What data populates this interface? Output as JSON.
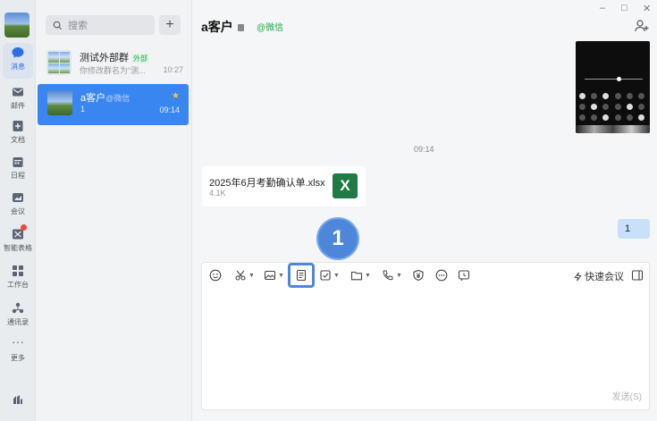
{
  "nav": {
    "items": [
      {
        "label": "消息",
        "icon": "chat-bubble-icon",
        "active": true
      },
      {
        "label": "邮件",
        "icon": "mail-icon"
      },
      {
        "label": "文档",
        "icon": "document-icon"
      },
      {
        "label": "日程",
        "icon": "calendar-icon"
      },
      {
        "label": "会议",
        "icon": "meeting-icon"
      },
      {
        "label": "智能表格",
        "icon": "smart-table-icon"
      },
      {
        "label": "工作台",
        "icon": "workbench-icon"
      },
      {
        "label": "通讯录",
        "icon": "contacts-icon"
      },
      {
        "label": "更多",
        "icon": "more-icon"
      }
    ]
  },
  "search": {
    "placeholder": "搜索"
  },
  "conversations": [
    {
      "name": "测试外部群",
      "tag": "外部",
      "preview": "你修改群名为“测...",
      "time": "10:27"
    },
    {
      "name": "a客户",
      "tag": "@微信",
      "preview": "1",
      "time": "09:14",
      "starred": true
    }
  ],
  "chat": {
    "title": "a客户",
    "tag": "@微信",
    "time_separator": "09:14",
    "file": {
      "name": "2025年6月考勤确认单.xlsx",
      "size": "4.1K",
      "badge": "X"
    },
    "my_message": "1",
    "step_badge": "1",
    "toolbar": {
      "quick_meeting": "快速会议"
    },
    "send_label": "发送(S)"
  },
  "window": {
    "minimize": "–",
    "maximize": "□",
    "close": "✕"
  }
}
